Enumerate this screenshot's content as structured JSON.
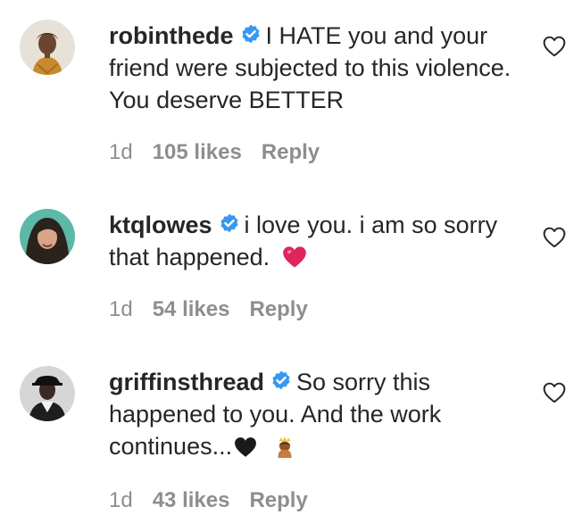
{
  "comments": [
    {
      "username": "robinthede",
      "text": "I HATE you and your friend were subjected to this violence. You deserve BETTER",
      "time": "1d",
      "likes": "105 likes",
      "reply": "Reply",
      "verified": true
    },
    {
      "username": "ktqlowes",
      "text": "i love you. i am so sorry that happened.",
      "time": "1d",
      "likes": "54 likes",
      "reply": "Reply",
      "verified": true,
      "trailing_emoji": "red-heart-emoji"
    },
    {
      "username": "griffinsthread",
      "text": "So sorry this happened to you. And the work continues...",
      "time": "1d",
      "likes": "43 likes",
      "reply": "Reply",
      "verified": true,
      "trailing_emoji": "black-heart-emoji, crowned-person-emoji"
    }
  ],
  "colors": {
    "text": "#262626",
    "meta": "#8e8e8e",
    "verified_badge": "#3897f0",
    "red_heart": "#e0245e"
  }
}
